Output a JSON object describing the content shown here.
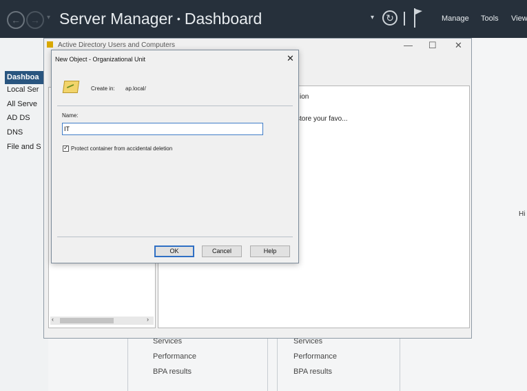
{
  "server_manager": {
    "title": "Server Manager",
    "breadcrumb_sep": "•",
    "page": "Dashboard",
    "menu": {
      "manage": "Manage",
      "tools": "Tools",
      "view": "View"
    }
  },
  "left_nav": {
    "items": [
      {
        "label": "Dashboa"
      },
      {
        "label": "Local Ser"
      },
      {
        "label": "All Serve"
      },
      {
        "label": "AD DS"
      },
      {
        "label": "DNS"
      },
      {
        "label": "File and S"
      }
    ]
  },
  "dashboard": {
    "tile_links_left": [
      "Services",
      "Performance",
      "BPA results"
    ],
    "tile_links_right": [
      "Services",
      "Performance",
      "BPA results"
    ],
    "right_cut": "Hi"
  },
  "aduc_window": {
    "title": "Active Directory Users and Computers",
    "controls": {
      "minimize": "—",
      "maximize": "☐",
      "close": "✕"
    },
    "pane_heading": "ion",
    "pane_text": "store your favo..."
  },
  "dialog": {
    "title": "New Object - Organizational Unit",
    "close": "✕",
    "create_in_label": "Create in:",
    "create_in_value": "ap.local/",
    "name_label": "Name:",
    "name_value": "IT",
    "protect_checked": true,
    "protect_label": "Protect container from accidental deletion",
    "buttons": {
      "ok": "OK",
      "cancel": "Cancel",
      "help": "Help"
    }
  }
}
